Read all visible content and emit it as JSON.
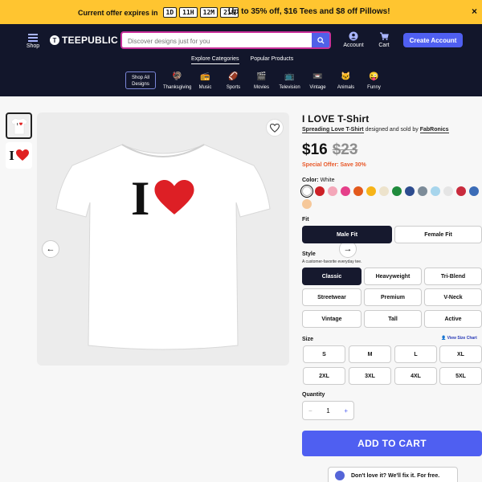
{
  "promo": {
    "prefix": "Current offer expires in",
    "timer": [
      "1D",
      "11H",
      "12M",
      "21S"
    ],
    "headline": "Up to 35% off, $16 Tees and $8 off Pillows!",
    "close": "×"
  },
  "header": {
    "shop_label": "Shop",
    "logo": "TEEPUBLIC",
    "search_placeholder": "Discover designs just for you",
    "account_label": "Account",
    "cart_label": "Cart",
    "create_account": "Create Account",
    "subnav": [
      "Explore Categories",
      "Popular Products"
    ],
    "shop_all": "Shop All Designs",
    "categories": [
      {
        "label": "Thanksgiving",
        "icon": "🦃",
        "color": "#2e2f5c"
      },
      {
        "label": "Music",
        "icon": "📻",
        "color": "#2e2f5c"
      },
      {
        "label": "Sports",
        "icon": "🏈",
        "color": "#2e2f5c"
      },
      {
        "label": "Movies",
        "icon": "🎬",
        "color": "#2e2f5c"
      },
      {
        "label": "Television",
        "icon": "📺",
        "color": "#2e2f5c"
      },
      {
        "label": "Vintage",
        "icon": "📼",
        "color": "#2e2f5c"
      },
      {
        "label": "Animals",
        "icon": "🐱",
        "color": "#2e2f5c"
      },
      {
        "label": "Funny",
        "icon": "😜",
        "color": "#2e2f5c"
      }
    ]
  },
  "product": {
    "title": "I LOVE T-Shirt",
    "subtitle_bold": "Spreading Love T-Shirt",
    "designed_by": "designed and sold by",
    "artist": "FabRonics",
    "price": "$16",
    "old_price": "$23",
    "offer": "Special Offer: Save 30%",
    "design_text": "I",
    "thumb2_text": "I",
    "color_label": "Color:",
    "color_value": "White",
    "colors": [
      "#ffffff",
      "#cc2026",
      "#f4a7b9",
      "#e5408a",
      "#e35a1c",
      "#f7b418",
      "#ede3cc",
      "#1f8b3c",
      "#2d4c8f",
      "#7d8c99",
      "#a7d5ec",
      "#e5e5e5",
      "#c92b3d",
      "#3b6cb7",
      "#f6c89a"
    ],
    "fit_label": "Fit",
    "fits": [
      "Male Fit",
      "Female Fit"
    ],
    "style_label": "Style",
    "style_sub": "A customer-favorite everyday tee.",
    "styles": [
      "Classic",
      "Heavyweight",
      "Tri-Blend",
      "Streetwear",
      "Premium",
      "V-Neck",
      "Vintage",
      "Tall",
      "Active"
    ],
    "size_label": "Size",
    "size_chart": "View Size Chart",
    "sizes": [
      "S",
      "M",
      "L",
      "XL",
      "2XL",
      "3XL",
      "4XL",
      "5XL"
    ],
    "quantity_label": "Quantity",
    "quantity": "1",
    "minus": "−",
    "plus": "+",
    "add_to_cart": "ADD TO CART",
    "guarantee_bold": "Don't love it? We'll fix it. For free."
  }
}
